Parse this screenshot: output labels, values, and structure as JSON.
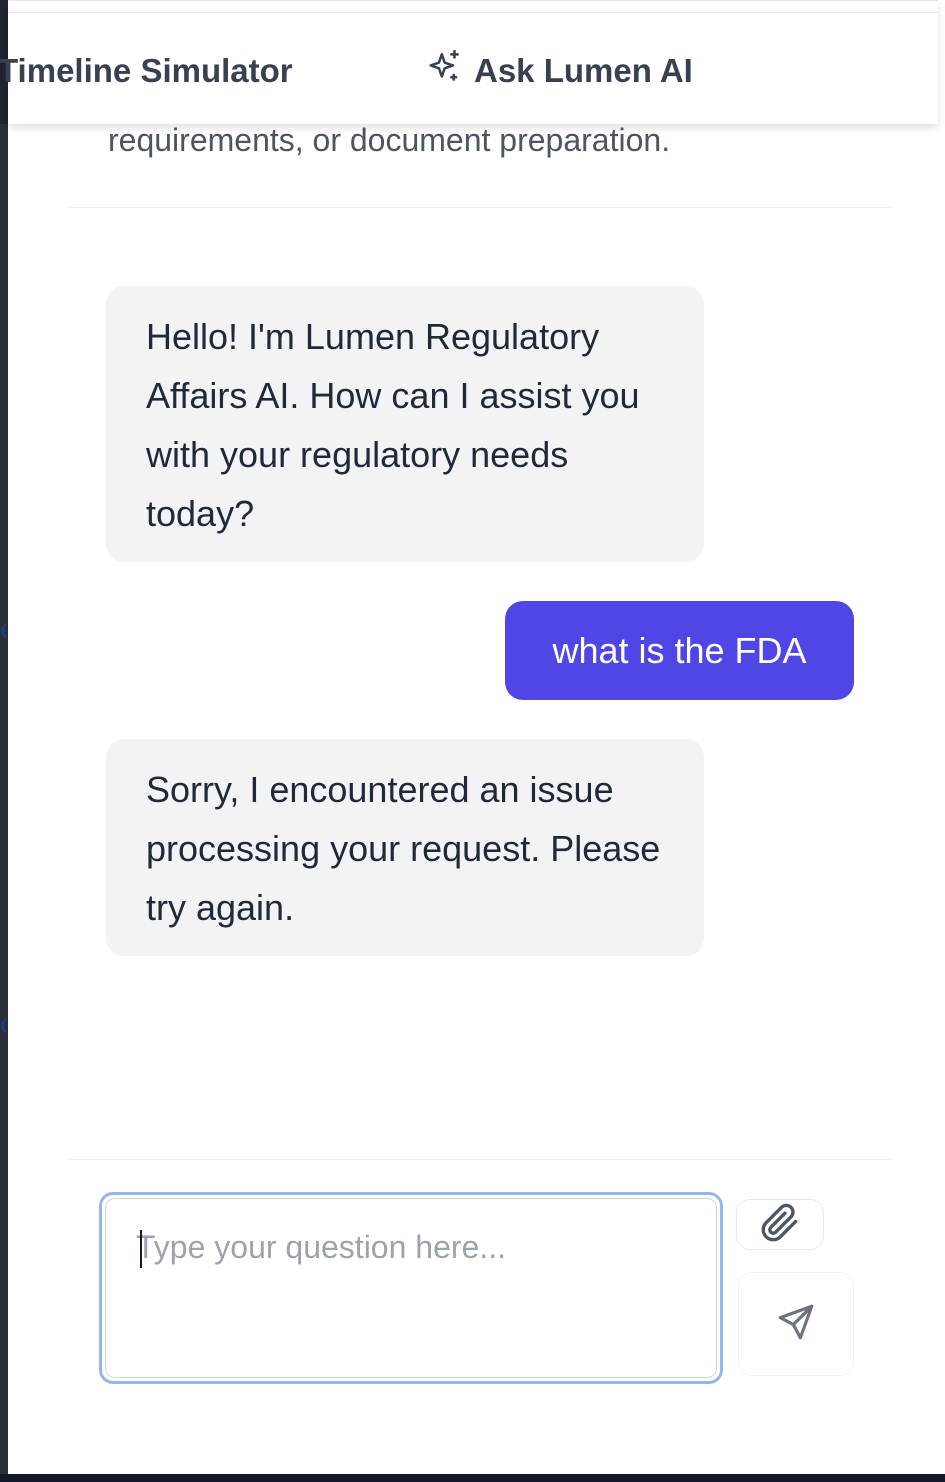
{
  "nav": {
    "timeline_label": "Timeline Simulator",
    "ask_label": "Ask Lumen AI",
    "ask_icon": "sparkles-icon"
  },
  "intro_tail": "requirements, or document preparation.",
  "messages": [
    {
      "role": "assistant",
      "text": "Hello! I'm Lumen Regulatory Affairs AI. How can I assist you with your regulatory needs today?"
    },
    {
      "role": "user",
      "text": "what is the FDA"
    },
    {
      "role": "assistant",
      "text": "Sorry, I encountered an issue processing your request. Please try again."
    }
  ],
  "composer": {
    "placeholder": "Type your question here...",
    "value": "",
    "attach_icon": "paperclip-icon",
    "send_icon": "send-icon"
  },
  "colors": {
    "user_bubble": "#4f46e5",
    "assistant_bubble": "#f2f3f5",
    "input_focus": "#93b7f0"
  }
}
